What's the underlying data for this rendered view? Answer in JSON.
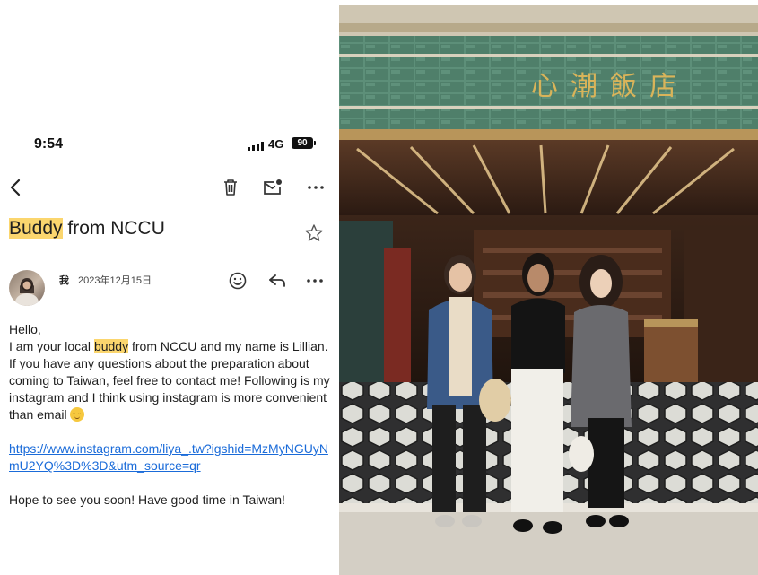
{
  "status": {
    "time": "9:54",
    "network": "4G",
    "battery": "90"
  },
  "toolbar": {
    "icons": [
      "back-icon",
      "delete-icon",
      "mark-unread-icon",
      "more-icon"
    ]
  },
  "email": {
    "subject_highlight": "Buddy",
    "subject_rest": " from NCCU",
    "sender": "我",
    "date": "2023年12月15日",
    "greeting": "Hello,",
    "line1_pre": " I am your local ",
    "line1_hl": "buddy",
    "line1_post": " from NCCU and my name is Lillian.",
    "line2": " If you have any questions about the preparation about coming to Taiwan, feel free to contact me! Following is my instagram and I think using instagram is more convenient than email",
    "link": "https://www.instagram.com/liya_.tw?igshid=MzMyNGUyNmU2YQ%3D%3D&utm_source=qr",
    "closing": "Hope to see you soon! Have good time in Taiwan!"
  },
  "photo": {
    "sign": "心潮飯店"
  },
  "colors": {
    "highlight": "#fbd66e",
    "link": "#1a6bd9",
    "sign_gold": "#d9b45a",
    "tile_green": "#4f7f6a"
  }
}
